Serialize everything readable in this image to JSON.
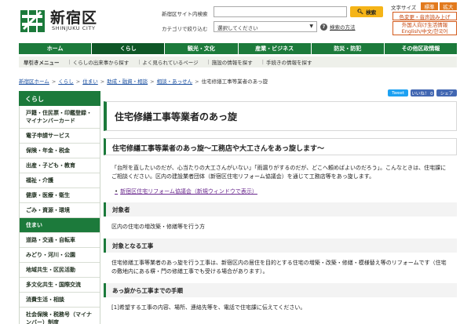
{
  "header": {
    "logo_ja": "新宿区",
    "logo_en": "SHINJUKU CITY",
    "search_label": "新宿区サイト内検索",
    "search_button": "検索",
    "category_label": "カテゴリで絞り込む",
    "category_value": "選択してください",
    "search_help": "検索の方法",
    "font_size_label": "文字サイズ",
    "font_std": "標準",
    "font_big": "拡大",
    "voice_btn": "色変更・音声読み上げ",
    "foreign_btn_line1": "外国人向け生活情報",
    "foreign_btn_line2": "English/中文/한국어"
  },
  "gnav": [
    "ホーム",
    "くらし",
    "観光・文化",
    "産業・ビジネス",
    "防災・防犯",
    "その他区政情報"
  ],
  "subnav": {
    "title": "早引きメニュー",
    "items": [
      "くらしの出来事から探す",
      "よく見られているページ",
      "施設の情報を探す",
      "手続きの情報を探す"
    ]
  },
  "breadcrumb": [
    "新宿区ホーム",
    "くらし",
    "住まい",
    "助成・融資・相談",
    "相談・あっせん",
    "住宅修繕工事等業者のあっ旋"
  ],
  "social": {
    "tweet": "Tweet",
    "like": "いいね！ 0",
    "share": "シェア"
  },
  "side": {
    "head": "くらし",
    "items": [
      "戸籍・住民票・印鑑登録・マイナンバーカード",
      "電子申請サービス",
      "保険・年金・税金",
      "出産・子ども・教育",
      "福祉・介護",
      "健康・医療・衛生",
      "ごみ・資源・環境",
      "住まい",
      "道路・交通・自転車",
      "みどり・河川・公園",
      "地域共生・区民活動",
      "多文化共生・国際交流",
      "消費生活・相談",
      "社会保険・税務号（マイナンバー）制度"
    ],
    "active_index": 7
  },
  "main": {
    "title": "住宅修繕工事等業者のあっ旋",
    "section_title": "住宅修繕工事等業者のあっ旋～工務店や大工さんをあっ旋します～",
    "intro": "「台所を直したいのだが、心当たりの大工さんがいない」「雨漏りがするのだが、どこへ頼めばよいのだろう」。こんなときは、住宅課にご相談ください。区内の建設業者団体（新宿区住宅リフォーム協議会）を通じて工務店等をあっ旋します。",
    "link": "新宿区住宅リフォーム協議会（新規ウィンドウで表示）",
    "h_target": "対象者",
    "p_target": "区内の住宅の増改築・修繕等を行う方",
    "h_work": "対象となる工事",
    "p_work": "住宅修繕工事等業者のあっ旋を行う工事は、新宿区内の居住を目的とする住宅の増築・改築・修繕・模様替え等のリフォームです（住宅の敷地内にある塀・門の修繕工事でも受ける場合があります）。",
    "h_flow": "あっ旋から工事までの手順",
    "p_flow": "[1]希望する工事の内容、場所、連絡先等を、電話で住宅課に伝えてください。"
  }
}
